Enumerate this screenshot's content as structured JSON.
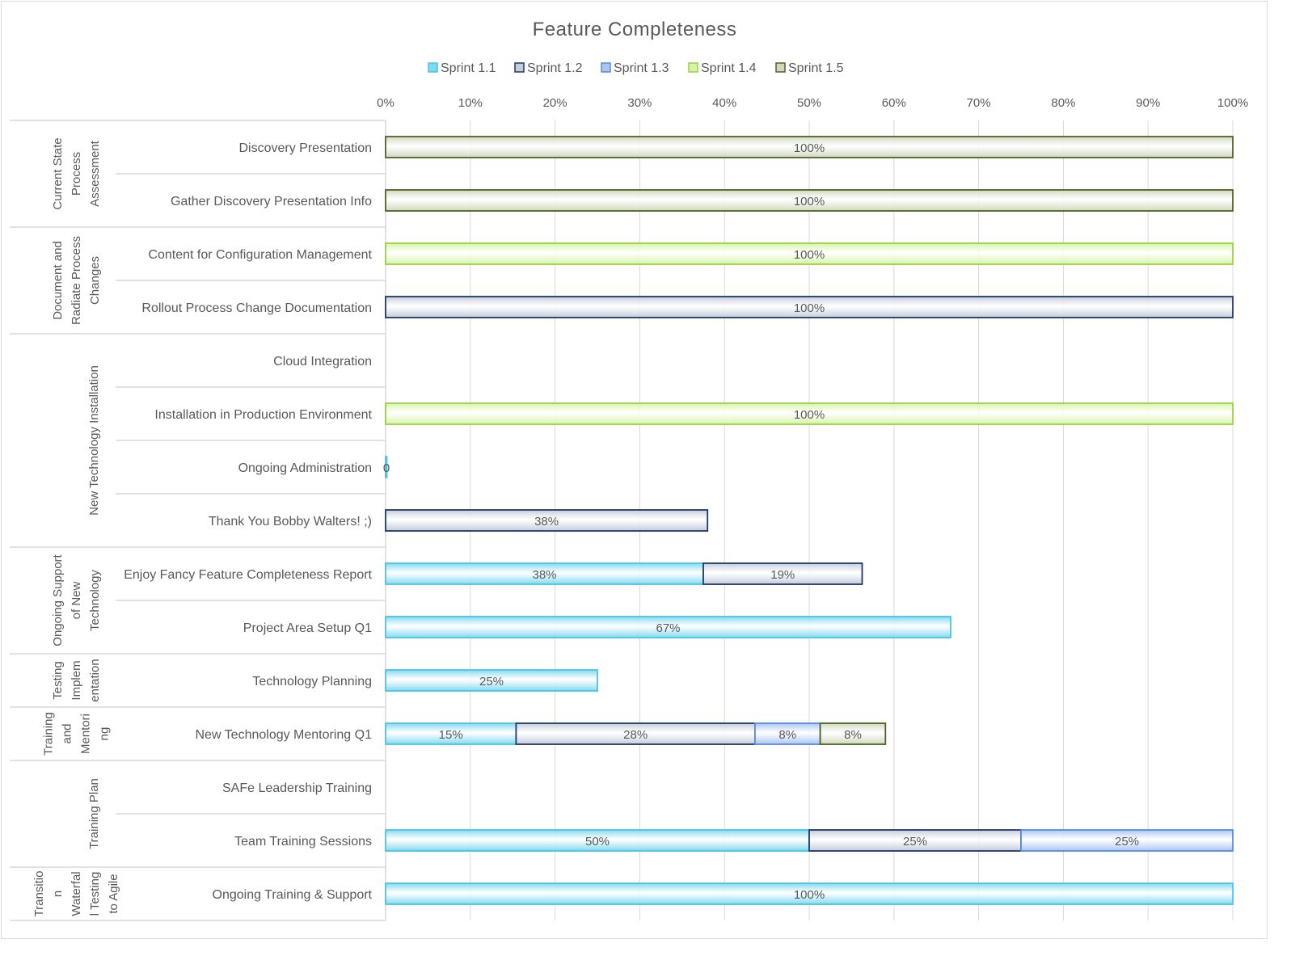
{
  "chart_data": {
    "type": "bar",
    "orientation": "horizontal",
    "stacked": true,
    "title": "Feature Completeness",
    "legend_position": "top",
    "grid": true,
    "xlim": [
      0,
      100
    ],
    "x_ticks": [
      "0%",
      "10%",
      "20%",
      "30%",
      "40%",
      "50%",
      "60%",
      "70%",
      "80%",
      "90%",
      "100%"
    ],
    "series": [
      {
        "name": "Sprint 1.1",
        "color": "#7fd9f0",
        "border": "#4ec3e0"
      },
      {
        "name": "Sprint 1.2",
        "color": "#c4cbd9",
        "border": "#1f3864"
      },
      {
        "name": "Sprint 1.3",
        "color": "#a9c4f5",
        "border": "#5b8ad6"
      },
      {
        "name": "Sprint 1.4",
        "color": "#d5f5a5",
        "border": "#9bd048"
      },
      {
        "name": "Sprint 1.5",
        "color": "#cfd8bd",
        "border": "#4f6228"
      }
    ],
    "groups": [
      {
        "label_lines": [
          "Current State",
          "Process",
          "Assessment"
        ],
        "rows": [
          0,
          1
        ]
      },
      {
        "label_lines": [
          "Document and",
          "Radiate Process",
          "Changes"
        ],
        "rows": [
          2,
          3
        ]
      },
      {
        "label_lines": [
          "New Technology Installation"
        ],
        "rows": [
          4,
          5,
          6,
          7
        ]
      },
      {
        "label_lines": [
          "Ongoing Support",
          "of New",
          "Technology"
        ],
        "rows": [
          8,
          9
        ]
      },
      {
        "label_lines": [
          "Testing",
          "Implem",
          "entation"
        ],
        "rows": [
          10
        ]
      },
      {
        "label_lines": [
          "Training",
          "and",
          "Mentori",
          "ng"
        ],
        "rows": [
          11
        ]
      },
      {
        "label_lines": [
          "Training Plan"
        ],
        "rows": [
          12,
          13
        ]
      },
      {
        "label_lines": [
          "Transitio",
          "n",
          "Waterfal",
          "l Testing",
          "to Agile"
        ],
        "rows": [
          14
        ]
      }
    ],
    "rows": [
      {
        "category": "Discovery Presentation",
        "segments": [
          {
            "series": 4,
            "value": 100,
            "label": "100%"
          }
        ]
      },
      {
        "category": "Gather Discovery Presentation Info",
        "segments": [
          {
            "series": 4,
            "value": 100,
            "label": "100%"
          }
        ]
      },
      {
        "category": "Content for Configuration Management",
        "segments": [
          {
            "series": 3,
            "value": 100,
            "label": "100%"
          }
        ]
      },
      {
        "category": "Rollout Process Change Documentation",
        "segments": [
          {
            "series": 1,
            "value": 100,
            "label": "100%"
          }
        ]
      },
      {
        "category": "Cloud Integration",
        "segments": []
      },
      {
        "category": "Installation in Production Environment",
        "segments": [
          {
            "series": 3,
            "value": 100,
            "label": "100%"
          }
        ]
      },
      {
        "category": "Ongoing Administration",
        "segments": [
          {
            "series": 0,
            "value": 0,
            "label": "0"
          }
        ]
      },
      {
        "category": "Thank You Bobby Walters! ;)",
        "segments": [
          {
            "series": 1,
            "value": 38,
            "label": "38%"
          }
        ]
      },
      {
        "category": "Enjoy Fancy Feature Completeness Report",
        "segments": [
          {
            "series": 0,
            "value": 37.5,
            "label": "38%"
          },
          {
            "series": 1,
            "value": 18.75,
            "label": "19%"
          }
        ]
      },
      {
        "category": "Project Area Setup Q1",
        "segments": [
          {
            "series": 0,
            "value": 66.7,
            "label": "67%"
          }
        ]
      },
      {
        "category": "Technology Planning",
        "segments": [
          {
            "series": 0,
            "value": 25,
            "label": "25%"
          }
        ]
      },
      {
        "category": "New Technology Mentoring Q1",
        "segments": [
          {
            "series": 0,
            "value": 15.4,
            "label": "15%"
          },
          {
            "series": 1,
            "value": 28.2,
            "label": "28%"
          },
          {
            "series": 2,
            "value": 7.7,
            "label": "8%"
          },
          {
            "series": 4,
            "value": 7.7,
            "label": "8%"
          }
        ]
      },
      {
        "category": "SAFe Leadership Training",
        "segments": []
      },
      {
        "category": "Team Training Sessions",
        "segments": [
          {
            "series": 0,
            "value": 50,
            "label": "50%"
          },
          {
            "series": 1,
            "value": 25,
            "label": "25%"
          },
          {
            "series": 2,
            "value": 25,
            "label": "25%"
          }
        ]
      },
      {
        "category": "Ongoing Training & Support",
        "segments": [
          {
            "series": 0,
            "value": 100,
            "label": "100%"
          }
        ]
      }
    ]
  }
}
